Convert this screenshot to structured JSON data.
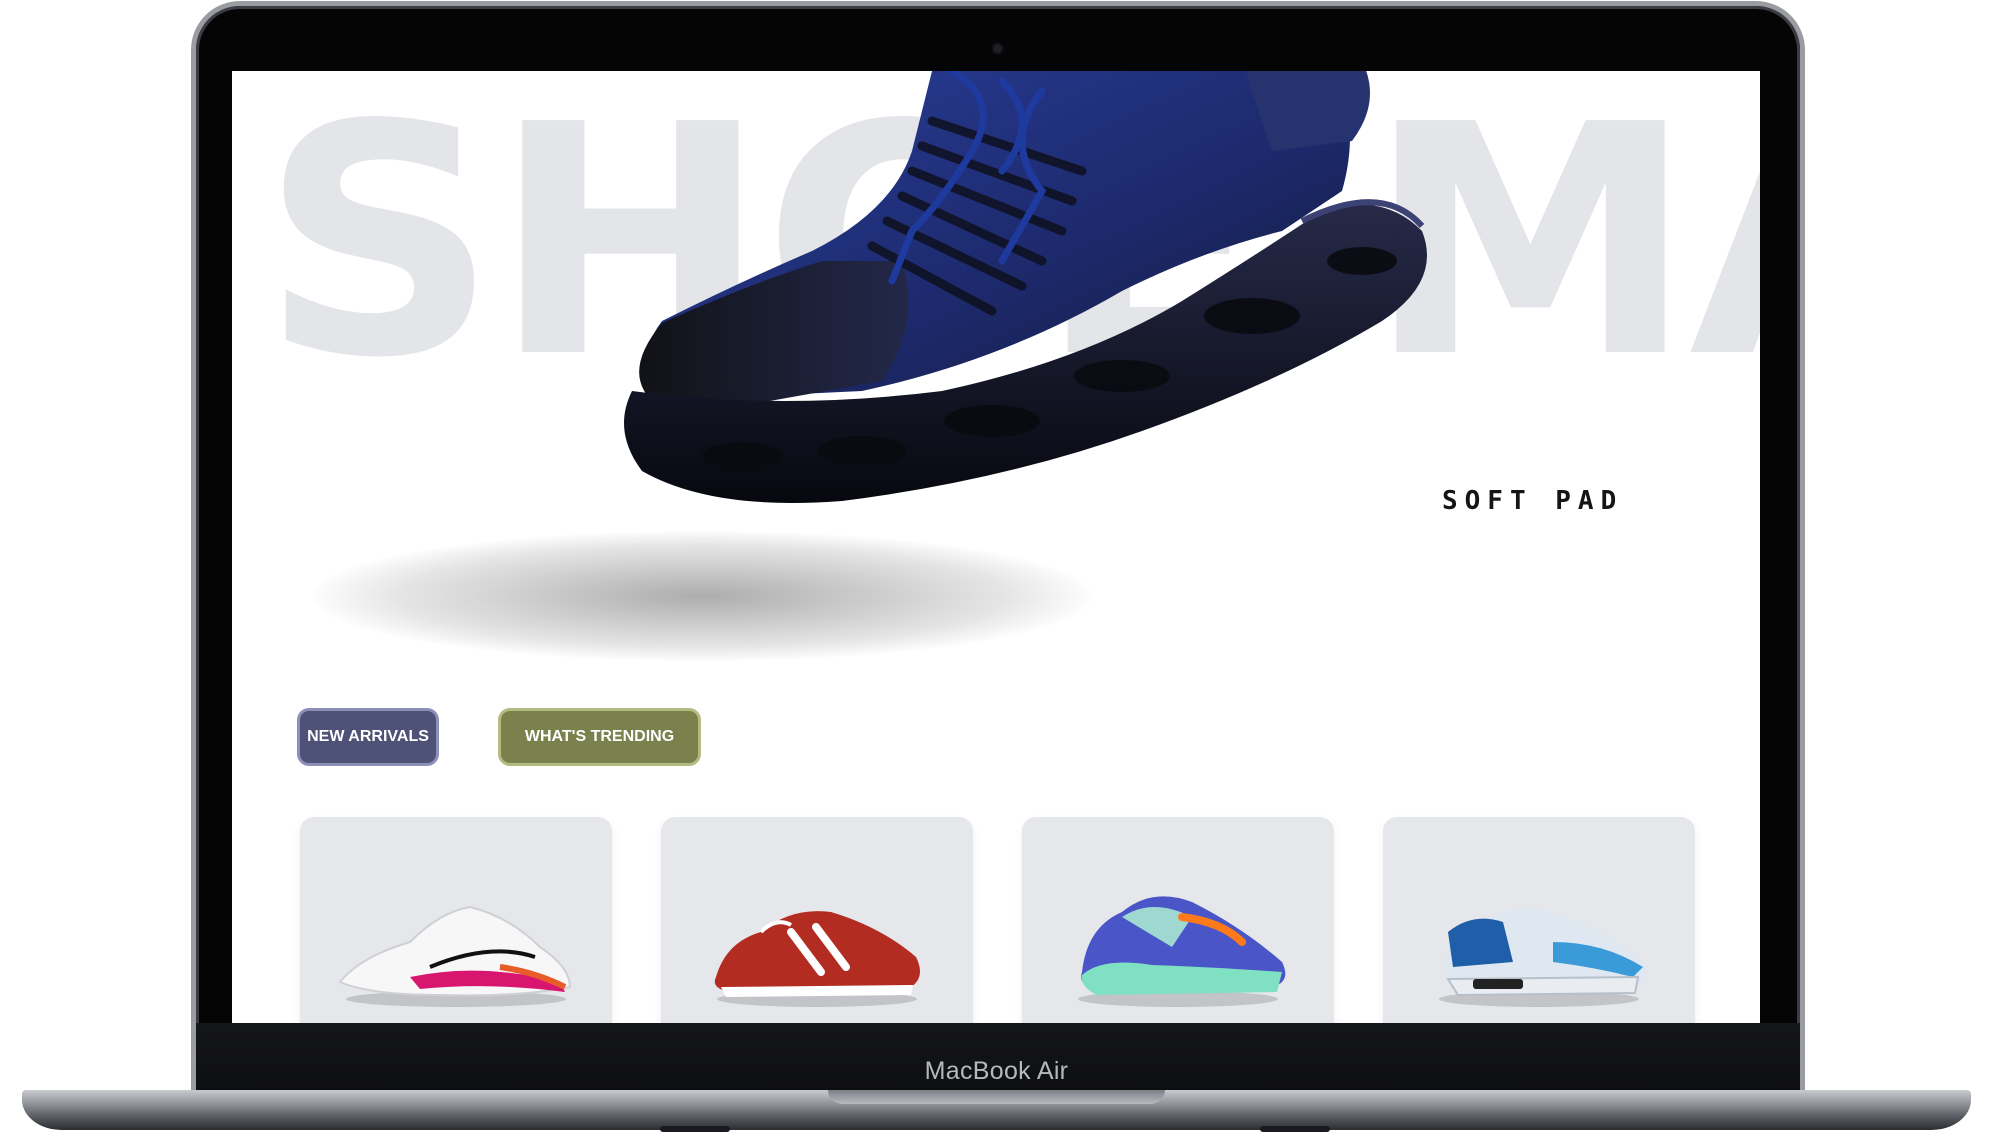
{
  "device": {
    "label": "MacBook Air"
  },
  "hero": {
    "background_word": "SHOE MALL",
    "tagline": "SOFT PAD"
  },
  "actions": {
    "new_arrivals": "NEW ARRIVALS",
    "whats_trending": "WHAT'S TRENDING"
  },
  "colors": {
    "new_arrivals_button": "#4d5276",
    "trending_button": "#7a814c",
    "card_background": "#e6e7eb",
    "background_word": "#e4e5e9"
  },
  "products": [
    {
      "icon": "white-running-shoe-icon",
      "color": "#ffffff"
    },
    {
      "icon": "red-sneaker-icon",
      "color": "#b22c22"
    },
    {
      "icon": "blue-green-basketball-shoe-icon",
      "color": "#4a55c8"
    },
    {
      "icon": "blue-air-sneaker-icon",
      "color": "#3b9ad8"
    }
  ]
}
